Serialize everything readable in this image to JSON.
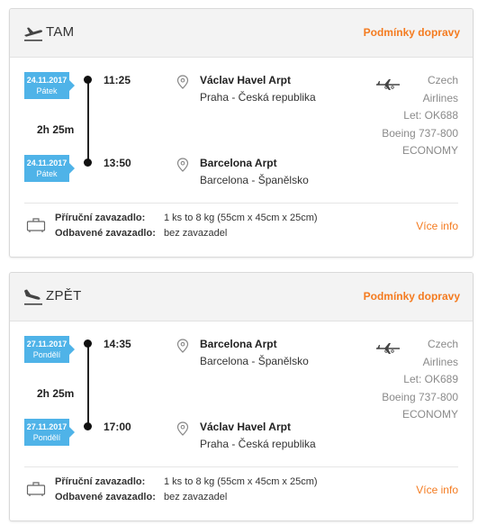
{
  "outbound": {
    "title": "TAM",
    "conditions_link": "Podmínky dopravy",
    "departure": {
      "date": "24.11.2017",
      "weekday": "Pátek",
      "time": "11:25",
      "airport": "Václav Havel Arpt",
      "city": "Praha - Česká republika"
    },
    "duration": "2h 25m",
    "arrival": {
      "date": "24.11.2017",
      "weekday": "Pátek",
      "time": "13:50",
      "airport": "Barcelona Arpt",
      "city": "Barcelona - Španělsko"
    },
    "airline": {
      "name_line1": "Czech",
      "name_line2": "Airlines",
      "flight": "Let: OK688",
      "aircraft": "Boeing 737-800",
      "cabin": "ECONOMY"
    },
    "baggage": {
      "hand_label": "Příruční zavazadlo:",
      "hand_value": "1 ks to 8 kg (55cm x 45cm x 25cm)",
      "checked_label": "Odbavené zavazadlo:",
      "checked_value": "bez zavazadel",
      "more": "Více info"
    }
  },
  "inbound": {
    "title": "ZPĚT",
    "conditions_link": "Podmínky dopravy",
    "departure": {
      "date": "27.11.2017",
      "weekday": "Pondělí",
      "time": "14:35",
      "airport": "Barcelona Arpt",
      "city": "Barcelona - Španělsko"
    },
    "duration": "2h 25m",
    "arrival": {
      "date": "27.11.2017",
      "weekday": "Pondělí",
      "time": "17:00",
      "airport": "Václav Havel Arpt",
      "city": "Praha - Česká republika"
    },
    "airline": {
      "name_line1": "Czech",
      "name_line2": "Airlines",
      "flight": "Let: OK689",
      "aircraft": "Boeing 737-800",
      "cabin": "ECONOMY"
    },
    "baggage": {
      "hand_label": "Příruční zavazadlo:",
      "hand_value": "1 ks to 8 kg (55cm x 45cm x 25cm)",
      "checked_label": "Odbavené zavazadlo:",
      "checked_value": "bez zavazadel",
      "more": "Více info"
    }
  },
  "colors": {
    "accent": "#f47b20",
    "badge": "#4fb3e8"
  }
}
